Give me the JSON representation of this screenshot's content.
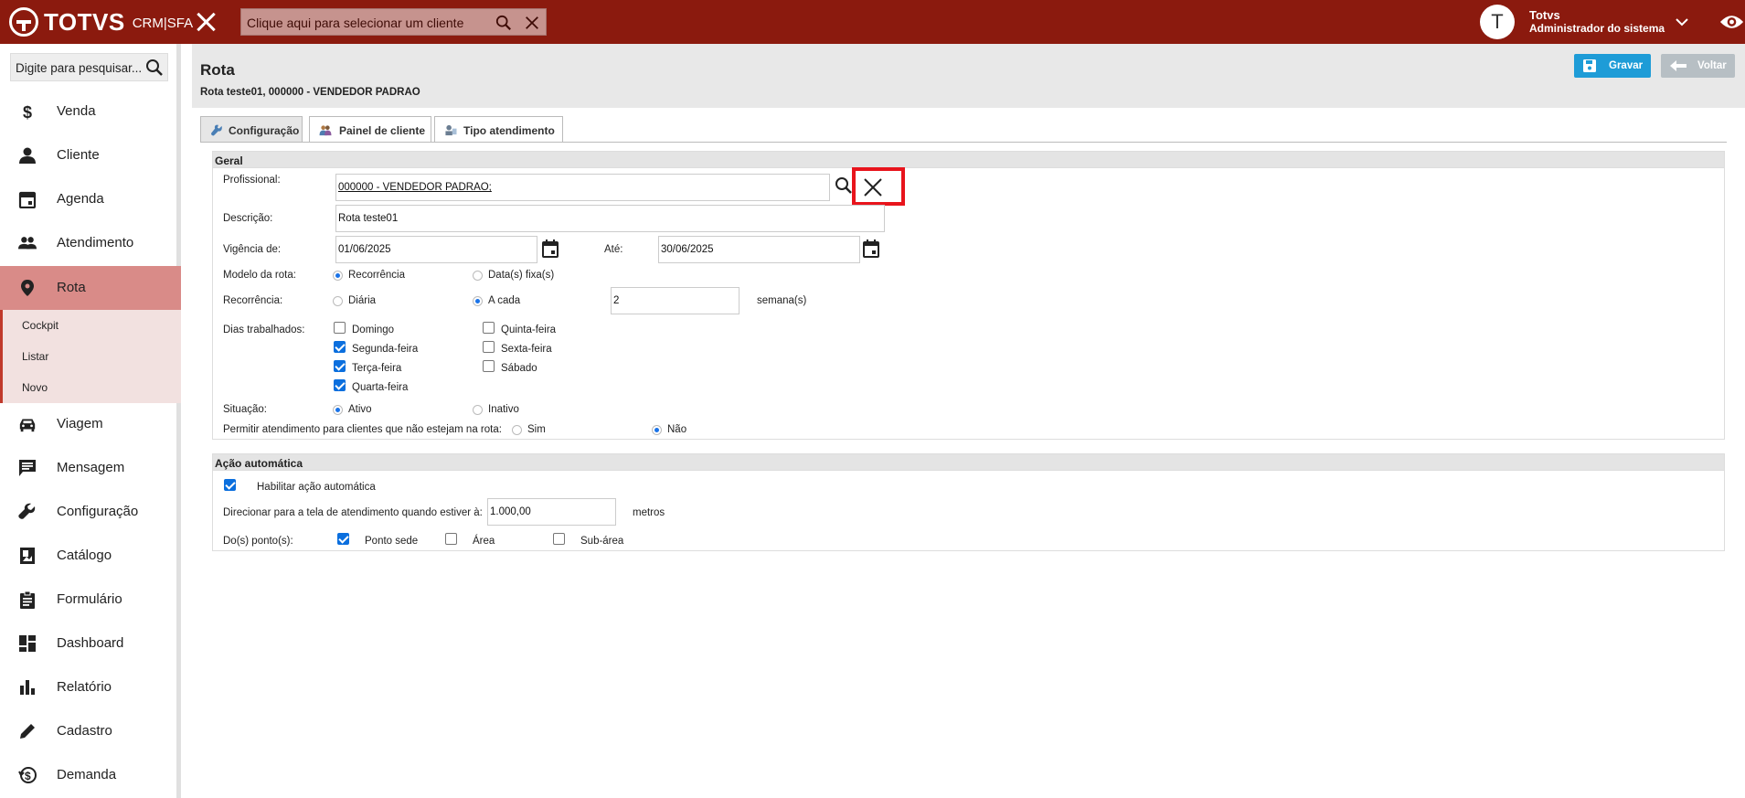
{
  "topbar": {
    "brand": "TOTVS",
    "product": "CRM|SFA",
    "client_placeholder": "Clique aqui para selecionar um cliente",
    "user_initial": "T",
    "user_name": "Totvs",
    "user_role": "Administrador do sistema",
    "colors": {
      "bar": "#8b1a0e"
    }
  },
  "sidebar": {
    "search_placeholder": "Digite para pesquisar...",
    "items": [
      {
        "label": "Venda",
        "icon": "dollar-icon"
      },
      {
        "label": "Cliente",
        "icon": "person-icon"
      },
      {
        "label": "Agenda",
        "icon": "calendar-icon"
      },
      {
        "label": "Atendimento",
        "icon": "people-icon"
      },
      {
        "label": "Rota",
        "icon": "location-pin-icon",
        "active": true
      },
      {
        "label": "Viagem",
        "icon": "car-icon"
      },
      {
        "label": "Mensagem",
        "icon": "message-icon"
      },
      {
        "label": "Configuração",
        "icon": "wrench-icon"
      },
      {
        "label": "Catálogo",
        "icon": "catalog-icon"
      },
      {
        "label": "Formulário",
        "icon": "clipboard-icon"
      },
      {
        "label": "Dashboard",
        "icon": "dashboard-icon"
      },
      {
        "label": "Relatório",
        "icon": "bar-chart-icon"
      },
      {
        "label": "Cadastro",
        "icon": "pencil-icon"
      },
      {
        "label": "Demanda",
        "icon": "demand-icon"
      }
    ],
    "subitems": [
      "Cockpit",
      "Listar",
      "Novo"
    ]
  },
  "page": {
    "title": "Rota",
    "subtitle": "Rota teste01, 000000 - VENDEDOR PADRAO",
    "save_label": "Gravar",
    "back_label": "Voltar"
  },
  "tabs": [
    "Configuração",
    "Painel de cliente",
    "Tipo atendimento"
  ],
  "geral": {
    "section_title": "Geral",
    "profissional_label": "Profissional:",
    "profissional_value": "000000 - VENDEDOR PADRAO;",
    "descricao_label": "Descrição:",
    "descricao_value": "Rota teste01",
    "vigencia_label": "Vigência de:",
    "vigencia_de": "01/06/2025",
    "ate_label": "Até:",
    "vigencia_ate": "30/06/2025",
    "modelo_label": "Modelo da rota:",
    "modelo_recorrencia": "Recorrência",
    "modelo_fixa": "Data(s) fixa(s)",
    "recorrencia_label": "Recorrência:",
    "rec_diaria": "Diária",
    "rec_acada": "A cada",
    "rec_valor": "2",
    "rec_unidade": "semana(s)",
    "dias_label": "Dias trabalhados:",
    "dias": {
      "domingo": "Domingo",
      "segunda": "Segunda-feira",
      "terca": "Terça-feira",
      "quarta": "Quarta-feira",
      "quinta": "Quinta-feira",
      "sexta": "Sexta-feira",
      "sabado": "Sábado"
    },
    "situacao_label": "Situação:",
    "sit_ativo": "Ativo",
    "sit_inativo": "Inativo",
    "permitir_label": "Permitir atendimento para clientes que não estejam na rota:",
    "perm_sim": "Sim",
    "perm_nao": "Não"
  },
  "acao": {
    "section_title": "Ação automática",
    "habilitar_label": "Habilitar ação automática",
    "direcionar_label": "Direcionar para a tela de atendimento quando estiver à:",
    "distancia_value": "1.000,00",
    "distancia_unidade": "metros",
    "pontos_label": "Do(s) ponto(s):",
    "ponto_sede": "Ponto sede",
    "area": "Área",
    "sub_area": "Sub-área"
  }
}
